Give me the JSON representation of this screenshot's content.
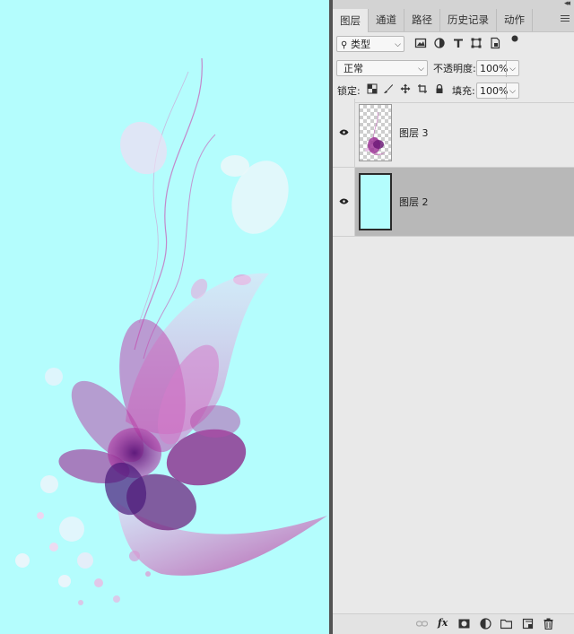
{
  "panel": {
    "tabs": [
      {
        "label": "图层",
        "active": true
      },
      {
        "label": "通道",
        "active": false
      },
      {
        "label": "路径",
        "active": false
      },
      {
        "label": "历史记录",
        "active": false
      },
      {
        "label": "动作",
        "active": false
      }
    ],
    "filter": {
      "label": "类型"
    },
    "blend_mode": "正常",
    "opacity": {
      "label": "不透明度:",
      "value": "100%"
    },
    "lock": {
      "label": "锁定:"
    },
    "fill": {
      "label": "填充:",
      "value": "100%"
    },
    "layers": [
      {
        "name": "图层 3",
        "visible": true,
        "selected": false,
        "thumbnail": "transparent-with-flower"
      },
      {
        "name": "图层 2",
        "visible": true,
        "selected": true,
        "thumbnail": "cyan-fill"
      }
    ],
    "icons": {
      "filter_icons": [
        "image-filter-icon",
        "adjustment-filter-icon",
        "type-filter-icon",
        "shape-filter-icon",
        "smart-object-filter-icon",
        "filter-toggle-icon"
      ],
      "lock_icons": [
        "lock-transparent-pixels-icon",
        "lock-image-pixels-icon",
        "lock-position-icon",
        "lock-artboard-icon",
        "lock-all-icon"
      ],
      "bottom_icons": [
        "link-layers-icon",
        "fx-icon",
        "add-mask-icon",
        "new-adjustment-layer-icon",
        "new-group-icon",
        "new-layer-icon",
        "delete-layer-icon"
      ]
    },
    "fx_text": "fx"
  },
  "canvas": {
    "background": "#b4fdfd",
    "flower_color": "#9a1f8c"
  }
}
